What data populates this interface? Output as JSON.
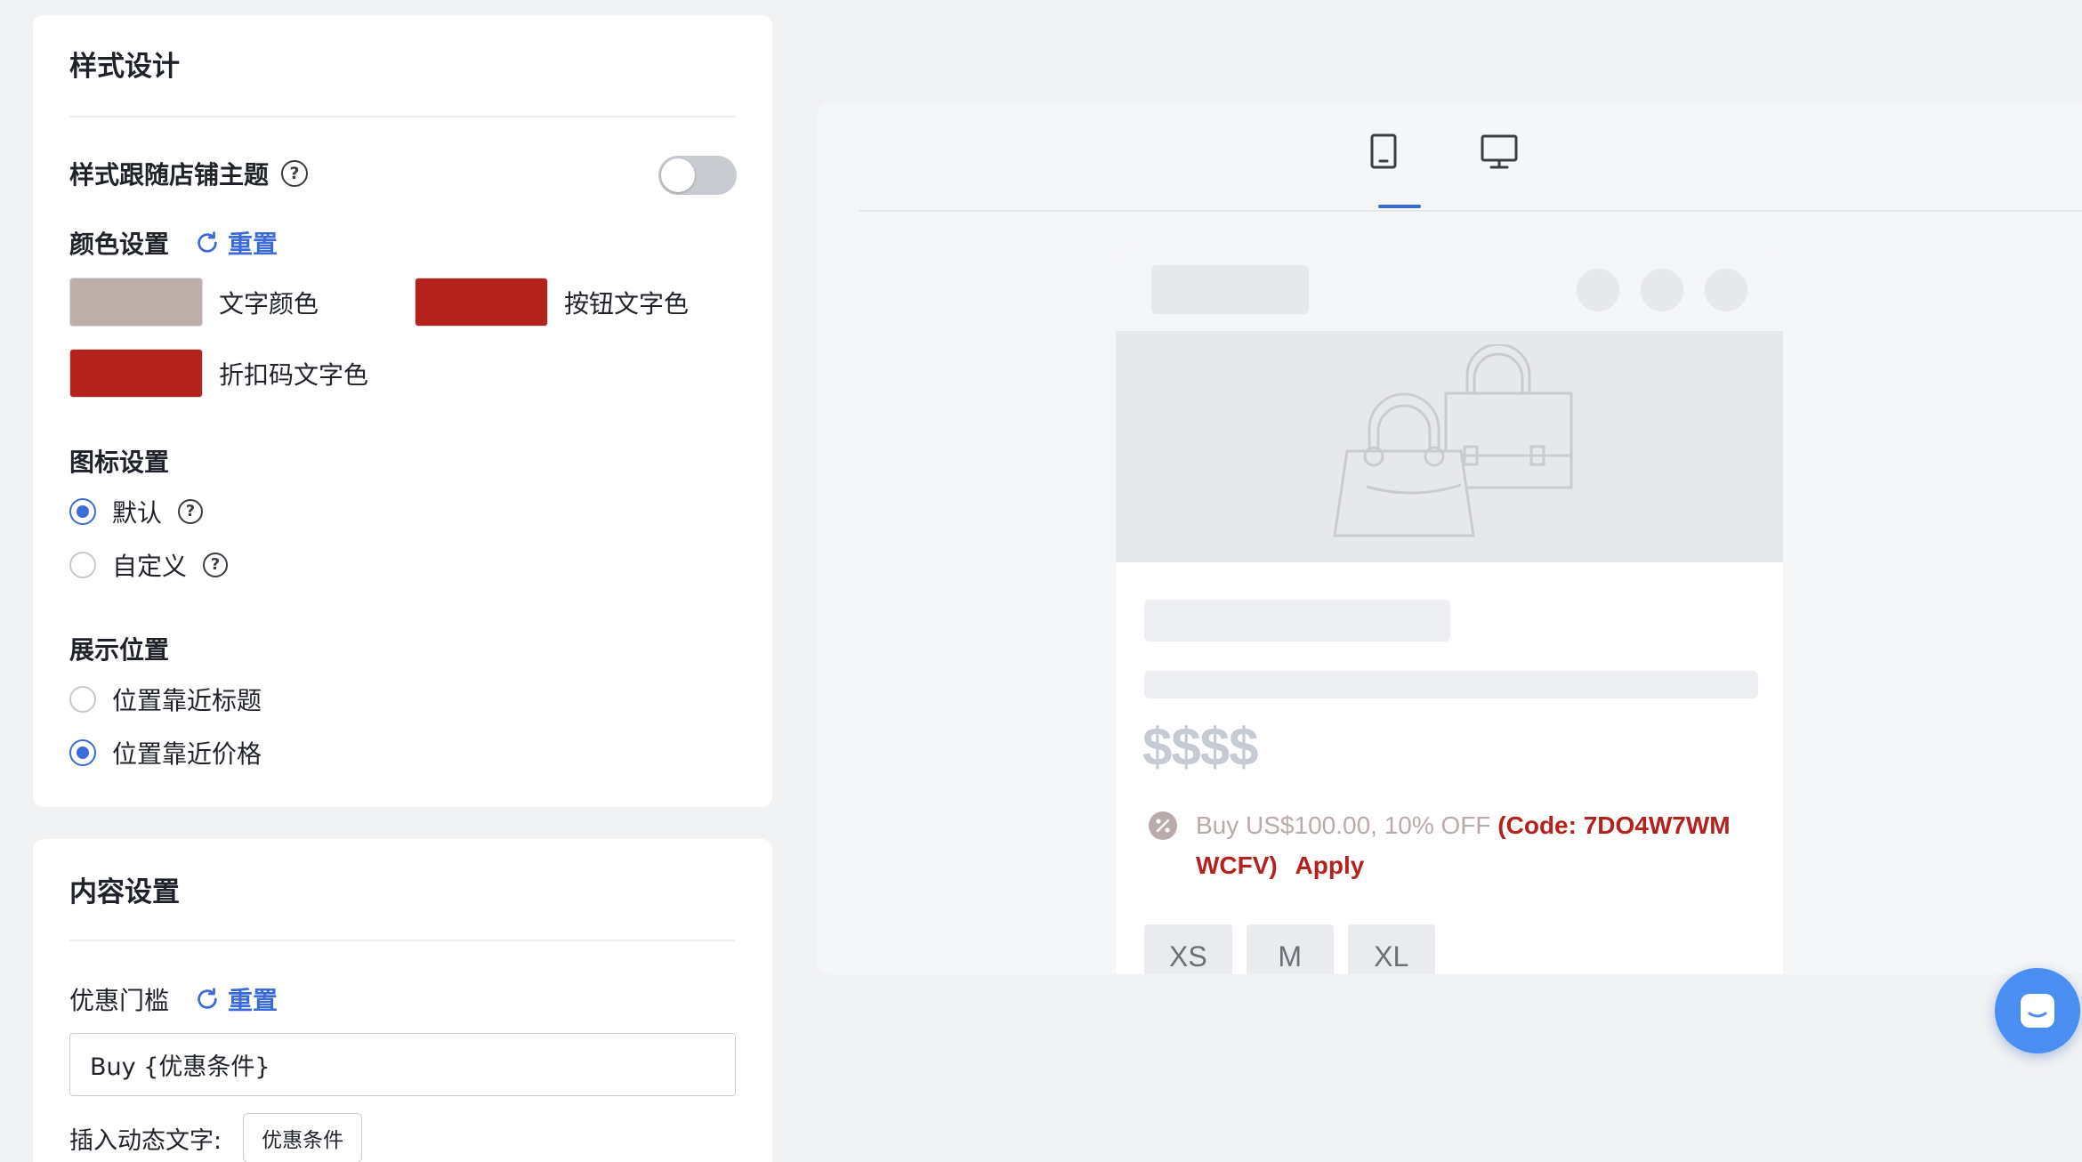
{
  "style_card": {
    "title": "样式设计",
    "follow_theme_label": "样式跟随店铺主题",
    "follow_theme_enabled": false,
    "color_settings_label": "颜色设置",
    "color_reset_label": "重置",
    "colors": {
      "text_color": {
        "label": "文字颜色",
        "value": "#bdaeaa"
      },
      "button_text_color": {
        "label": "按钮文字色",
        "value": "#b3221c"
      },
      "code_text_color": {
        "label": "折扣码文字色",
        "value": "#b3221c"
      }
    },
    "icon_settings_label": "图标设置",
    "icon_options": [
      {
        "label": "默认",
        "checked": true
      },
      {
        "label": "自定义",
        "checked": false
      }
    ],
    "position_label": "展示位置",
    "position_options": [
      {
        "label": "位置靠近标题",
        "checked": false
      },
      {
        "label": "位置靠近价格",
        "checked": true
      }
    ]
  },
  "content_card": {
    "title": "内容设置",
    "threshold_label": "优惠门槛",
    "threshold_reset_label": "重置",
    "threshold_value": "Buy {优惠条件}",
    "insert_label": "插入动态文字:",
    "insert_tag": "优惠条件"
  },
  "preview": {
    "active_device": "mobile",
    "price_placeholder": "$$$$",
    "discount_text": "Buy US$100.00, 10% OFF",
    "discount_code_text": "(Code: 7DO4W7WM WCFV)",
    "apply_label": "Apply",
    "sizes": [
      "XS",
      "M",
      "XL"
    ]
  },
  "icons": {
    "help": "question-circle-icon",
    "reset": "refresh-icon",
    "mobile": "mobile-device-icon",
    "desktop": "desktop-monitor-icon",
    "discount": "percent-badge-icon",
    "chat": "chat-icon"
  },
  "accent_color": "#3c6ad9"
}
